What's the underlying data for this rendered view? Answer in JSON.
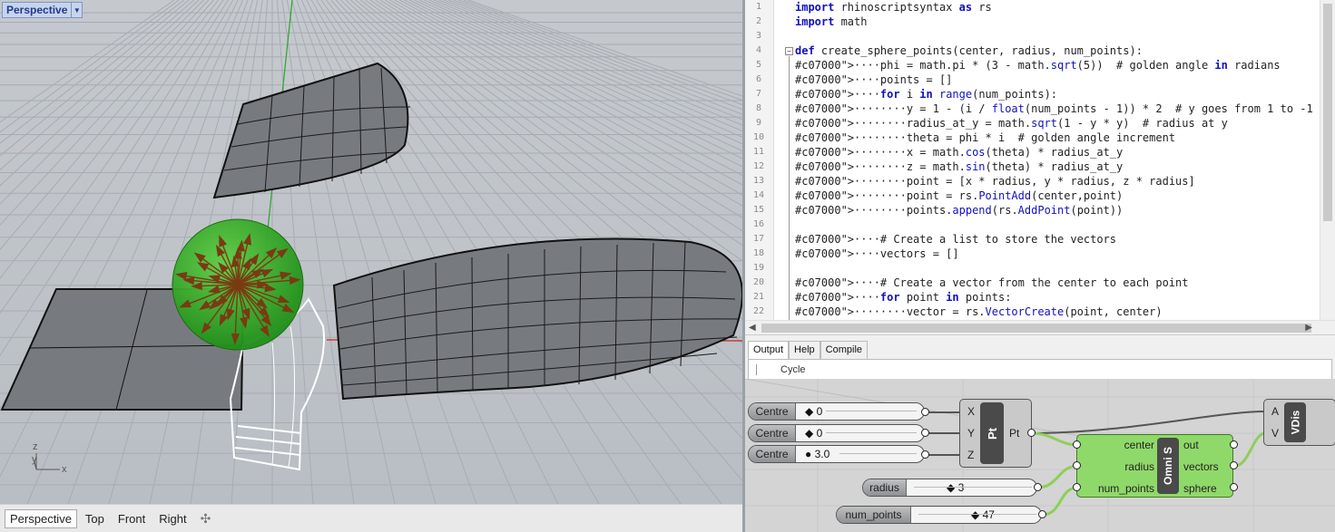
{
  "viewport": {
    "title": "Perspective",
    "axis_labels": {
      "z": "z",
      "y": "y",
      "x": "x"
    },
    "tabs": [
      "Perspective",
      "Top",
      "Front",
      "Right"
    ],
    "add_tab_icon": "plus-icon"
  },
  "editor": {
    "line_numbers": [
      "1",
      "2",
      "3",
      "4",
      "5",
      "6",
      "7",
      "8",
      "9",
      "10",
      "11",
      "12",
      "13",
      "14",
      "15",
      "16",
      "17",
      "18",
      "19",
      "20",
      "21",
      "22"
    ],
    "lines": [
      "import rhinoscriptsyntax as rs",
      "import math",
      "",
      "def create_sphere_points(center, radius, num_points):",
      "····phi = math.pi * (3 - math.sqrt(5))  # golden angle in radians",
      "····points = []",
      "····for i in range(num_points):",
      "········y = 1 - (i / float(num_points - 1)) * 2  # y goes from 1 to -1",
      "········radius_at_y = math.sqrt(1 - y * y)  # radius at y",
      "········theta = phi * i  # golden angle increment",
      "········x = math.cos(theta) * radius_at_y",
      "········z = math.sin(theta) * radius_at_y",
      "········point = [x * radius, y * radius, z * radius]",
      "········point = rs.PointAdd(center,point)",
      "········points.append(rs.AddPoint(point))",
      "",
      "····# Create a list to store the vectors",
      "····vectors = []",
      "",
      "····# Create a vector from the center to each point",
      "····for point in points:",
      "········vector = rs.VectorCreate(point, center)"
    ]
  },
  "output_panel": {
    "tabs": [
      "Output",
      "Help",
      "Compile"
    ],
    "active_tab": "Output",
    "text": "Cycle"
  },
  "grasshopper": {
    "sliders": [
      {
        "label": "Centre",
        "value": "0"
      },
      {
        "label": "Centre",
        "value": "0"
      },
      {
        "label": "Centre",
        "value": "3.0"
      },
      {
        "label": "radius",
        "value": "3"
      },
      {
        "label": "num_points",
        "value": "47"
      }
    ],
    "pt_component": {
      "inputs": [
        "X",
        "Y",
        "Z"
      ],
      "name": "Pt",
      "output": "Pt"
    },
    "script_component": {
      "inputs": [
        "center",
        "radius",
        "num_points"
      ],
      "name": "Omni S",
      "outputs": [
        "out",
        "vectors",
        "sphere"
      ]
    },
    "vdisplay_component": {
      "inputs": [
        "A",
        "V"
      ],
      "name": "VDis"
    },
    "colors": {
      "canvas": "#d4d4d4",
      "script_fill": "#8fd96a",
      "wire_active": "#8ecf55",
      "wire_default": "#555555"
    }
  }
}
